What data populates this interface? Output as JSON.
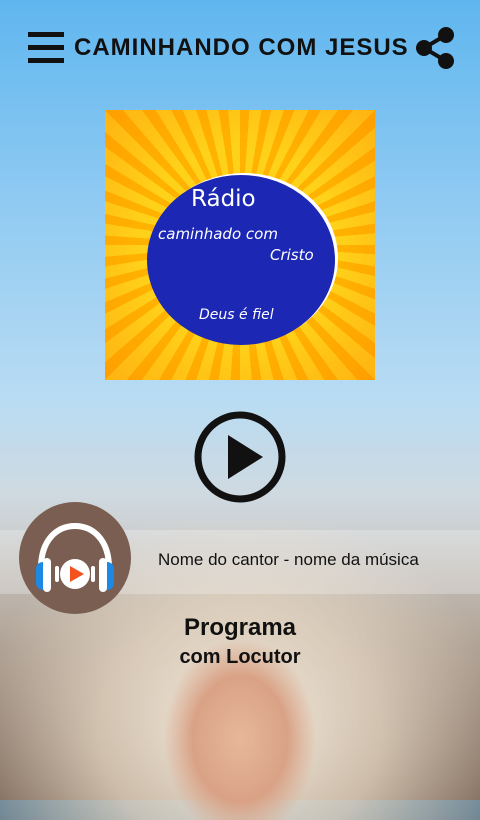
{
  "header": {
    "title": "CAMINHANDO COM JESUS",
    "menu_icon": "hamburger-menu-icon",
    "share_icon": "share-icon"
  },
  "logo": {
    "heading": "Rádio",
    "line1": "caminhado com",
    "line2": "Cristo",
    "tagline": "Deus é fiel"
  },
  "player": {
    "play_icon": "play-icon",
    "now_playing": "Nome do cantor - nome da música",
    "avatar_icon": "headphones-play-icon",
    "program_title": "Programa",
    "program_host": "com Locutor"
  },
  "colors": {
    "logo_circle": "#1c27b4",
    "logo_background": "#ffc107",
    "avatar_background": "#7b5e52",
    "headphones": "#1e88e5",
    "play_accent": "#f4511e"
  }
}
